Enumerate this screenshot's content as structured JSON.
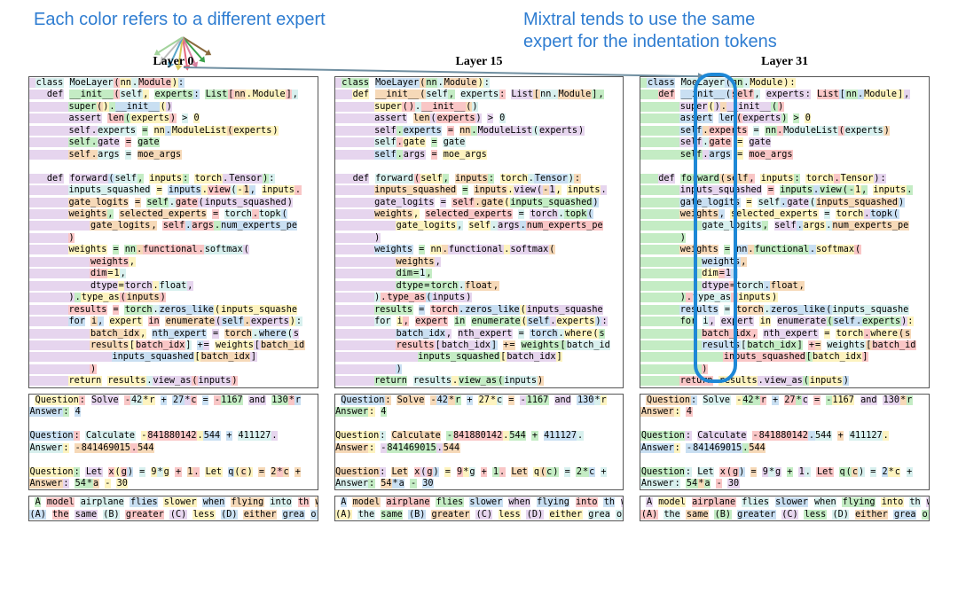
{
  "annotations": {
    "left": "Each color refers to a different expert",
    "right": "Mixtral tends to use the same\nexpert for the indentation tokens"
  },
  "expert_colors": {
    "e0": "#f9c6c6",
    "e1": "#c4ecc4",
    "e2": "#fdf3bf",
    "e3": "#c9dff2",
    "e4": "#e6d5ee",
    "e5": "#f6d9b8",
    "e6": "#d8f0ee",
    "e7": "#efefef"
  },
  "fan_colors": [
    "#8a6b3e",
    "#3aa14a",
    "#d7809f",
    "#e4677c",
    "#d7c95b",
    "#5aa6c8",
    "#bdbdbd",
    "#a3d39c"
  ],
  "columns": [
    "Layer 0",
    "Layer 15",
    "Layer 31"
  ],
  "code_panel": {
    "lines": [
      " class MoeLayer(nn.Module):",
      "   def __init__(self, experts: List[nn.Module],",
      "       super().__init__()",
      "       assert len(experts) > 0",
      "       self.experts = nn.ModuleList(experts)",
      "       self.gate = gate",
      "       self.args = moe_args",
      "",
      "   def forward(self, inputs: torch.Tensor):",
      "       inputs_squashed = inputs.view(-1, inputs.",
      "       gate_logits = self.gate(inputs_squashed)",
      "       weights, selected_experts = torch.topk(",
      "           gate_logits, self.args.num_experts_pe",
      "       )",
      "       weights = nn.functional.softmax(",
      "           weights,",
      "           dim=1,",
      "           dtype=torch.float,",
      "       ).type_as(inputs)",
      "       results = torch.zeros_like(inputs_squashe",
      "       for i, expert in enumerate(self.experts):",
      "           batch_idx, nth_expert = torch.where(s",
      "           results[batch_idx] += weights[batch_id",
      "               inputs_squashed[batch_idx]",
      "           )",
      "       return results.view_as(inputs)"
    ]
  },
  "math_panel": {
    "lines": [
      " Question: Solve -42*r + 27*c = -1167 and 130*r",
      "Answer: 4",
      "",
      "Question: Calculate -841880142.544 + 411127.",
      "Answer: -841469015.544",
      "",
      "Question: Let x(g) = 9*g + 1. Let q(c) = 2*c +",
      "Answer: 54*a - 30"
    ]
  },
  "text_panel": {
    "content": " A model airplane flies slower when flying into th wind and faster with wind at its back. When launch right angles to the wind, a cross wind, its ground compared with flying in still air is\n(A) the same (B) greater (C) less (D) either grea or less depending on wind speed"
  }
}
